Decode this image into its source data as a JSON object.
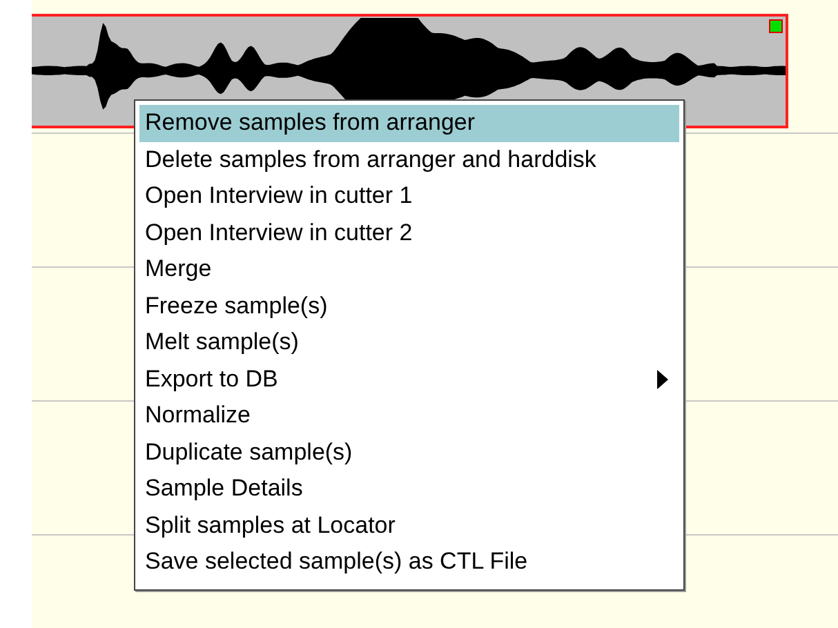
{
  "menu": {
    "items": [
      {
        "label": "Remove samples from arranger",
        "kind": "action",
        "selected": true
      },
      {
        "label": "Delete samples from arranger and harddisk",
        "kind": "action",
        "selected": false
      },
      {
        "label": "Open Interview in cutter 1",
        "kind": "action",
        "selected": false
      },
      {
        "label": "Open Interview in cutter 2",
        "kind": "action",
        "selected": false
      },
      {
        "label": "Merge",
        "kind": "action",
        "selected": false
      },
      {
        "label": "Freeze sample(s)",
        "kind": "action",
        "selected": false
      },
      {
        "label": "Melt sample(s)",
        "kind": "action",
        "selected": false
      },
      {
        "label": "Export to DB",
        "kind": "submenu",
        "selected": false
      },
      {
        "label": "Normalize",
        "kind": "action",
        "selected": false
      },
      {
        "label": "Duplicate sample(s)",
        "kind": "action",
        "selected": false
      },
      {
        "label": "Sample Details",
        "kind": "action",
        "selected": false
      },
      {
        "label": "Split samples at Locator",
        "kind": "action",
        "selected": false
      },
      {
        "label": "Save selected sample(s) as CTL File",
        "kind": "action",
        "selected": false
      }
    ]
  }
}
